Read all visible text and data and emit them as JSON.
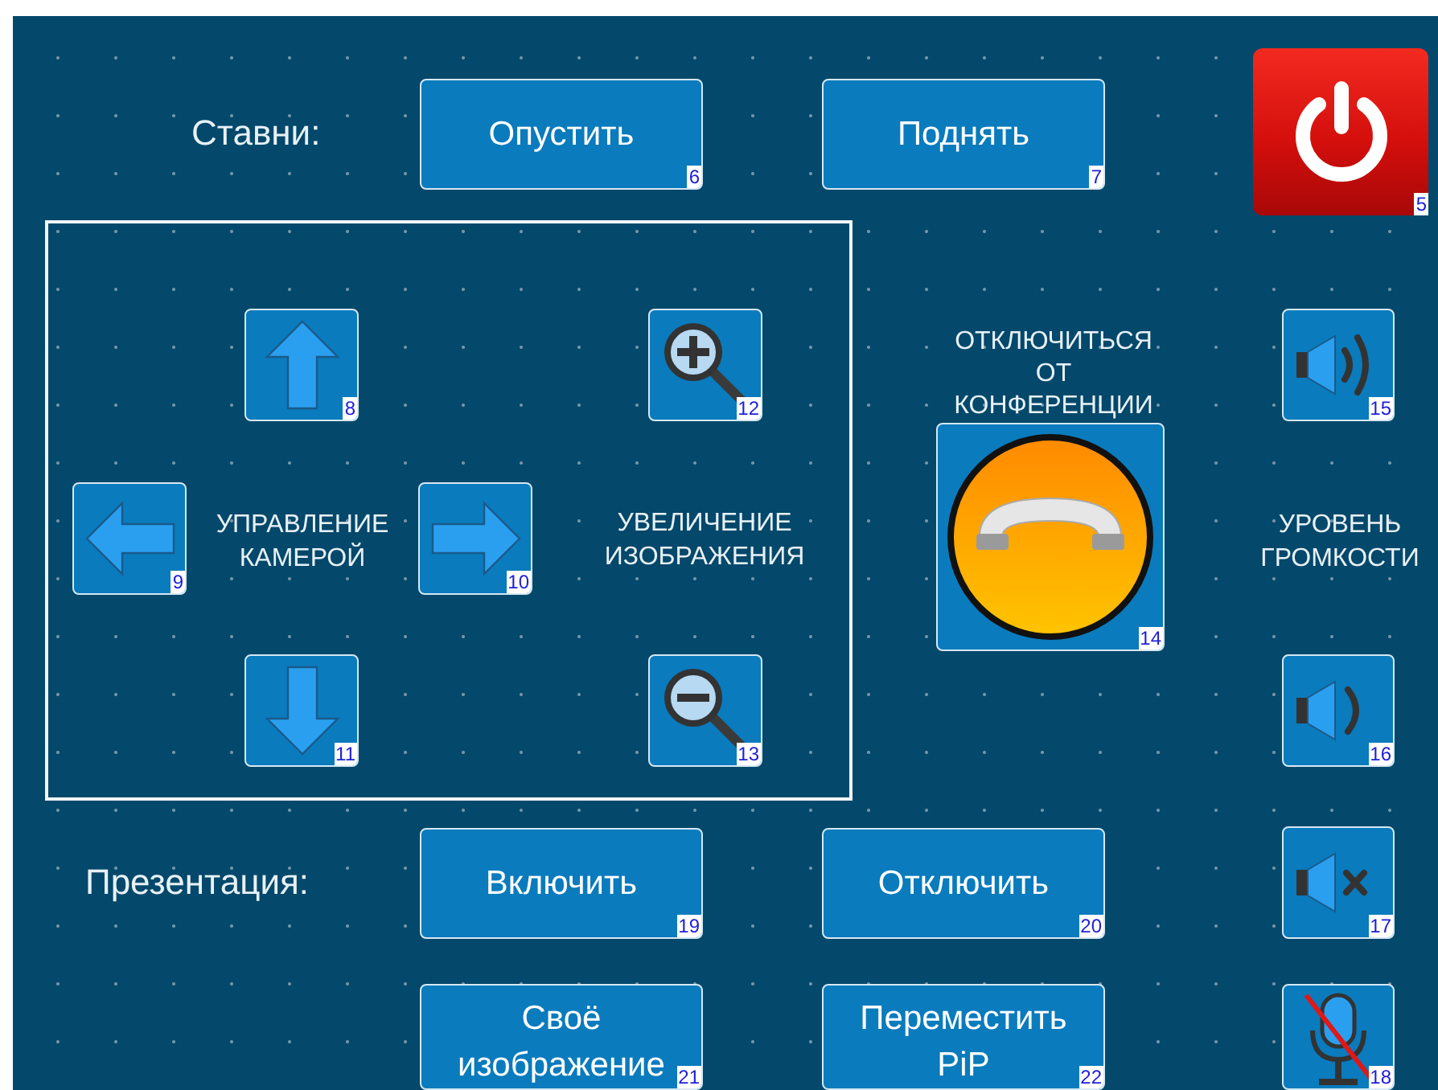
{
  "shutters": {
    "label": "Ставни:",
    "buttons": [
      {
        "label": "Опустить",
        "number": "6"
      },
      {
        "label": "Поднять",
        "number": "7"
      }
    ]
  },
  "power_button": {
    "number": "5"
  },
  "camera_panel": {
    "camera_label": "УПРАВЛЕНИЕ КАМЕРОЙ",
    "zoom_label": "УВЕЛИЧЕНИЕ ИЗОБРАЖЕНИЯ",
    "buttons": [
      {
        "kind": "up",
        "number": "8"
      },
      {
        "kind": "zoom-in",
        "number": "12"
      },
      {
        "kind": "left",
        "number": "9"
      },
      {
        "kind": "right",
        "number": "10"
      },
      {
        "kind": "down",
        "number": "11"
      },
      {
        "kind": "zoom-out",
        "number": "13"
      }
    ]
  },
  "conference": {
    "label": "ОТКЛЮЧИТЬСЯ ОТ КОНФЕРЕНЦИИ",
    "hangup_button": {
      "number": "14"
    }
  },
  "volume": {
    "label": "УРОВЕНЬ ГРОМКОСТИ",
    "buttons": [
      {
        "kind": "louder",
        "number": "15"
      },
      {
        "kind": "quieter",
        "number": "16"
      },
      {
        "kind": "mute",
        "number": "17"
      },
      {
        "kind": "mic-off",
        "number": "18"
      }
    ]
  },
  "presentation": {
    "label": "Презентация:",
    "buttons": [
      {
        "label": "Включить",
        "number": "19"
      },
      {
        "label": "Отключить",
        "number": "20"
      },
      {
        "label": "Своё изображение",
        "number": "21"
      },
      {
        "label": "Переместить PiP",
        "number": "22"
      }
    ]
  }
}
